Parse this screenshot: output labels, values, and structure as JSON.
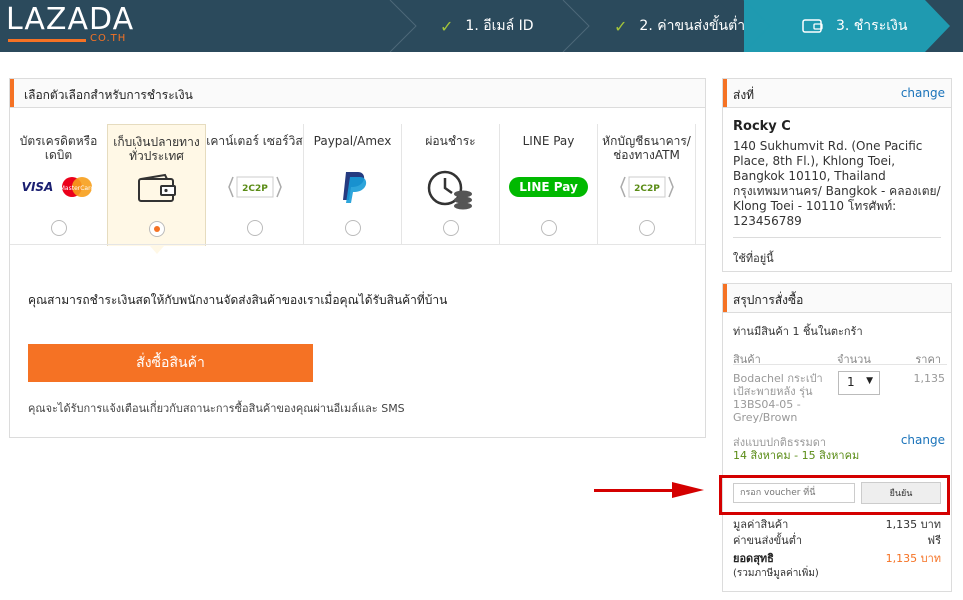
{
  "brand": {
    "logo_text": "LAZADA",
    "logo_sub": "CO.TH",
    "accent": "#f57224"
  },
  "steps": [
    {
      "label": "1. อีเมล์ ID",
      "done": true
    },
    {
      "label": "2. ค่าขนส่งขั้นต่ำ",
      "done": true
    },
    {
      "label": "3. ชำระเงิน",
      "done": false,
      "active": true
    }
  ],
  "payment": {
    "title": "เลือกตัวเลือกสำหรับการชำระเงิน",
    "methods": [
      {
        "label": "บัตรเครดิตหรือ เดบิต",
        "icon": "visa-mastercard-icon"
      },
      {
        "label": "เก็บเงินปลายทาง ทั่วประเทศ",
        "icon": "wallet-icon",
        "selected": true
      },
      {
        "label": "เคาน์เตอร์ เซอร์วิส",
        "icon": "counter-service-icon"
      },
      {
        "label": "Paypal/Amex",
        "icon": "paypal-icon"
      },
      {
        "label": "ผ่อนชำระ",
        "icon": "installment-icon"
      },
      {
        "label": "LINE Pay",
        "icon": "line-pay-icon",
        "badge": "LINE Pay"
      },
      {
        "label": "หักบัญชีธนาคาร/ ช่องทางATM",
        "icon": "bank-atm-icon"
      }
    ],
    "visa_text": "VISA",
    "mastercard_text": "MasterCard",
    "twoc2p_text": "2C2P",
    "description": "คุณสามารถชำระเงินสดให้กับพนักงานจัดส่งสินค้าของเราเมื่อคุณได้รับสินค้าที่บ้าน",
    "order_button": "สั่งซื้อสินค้า",
    "notify": "คุณจะได้รับการแจ้งเตือนเกี่ยวกับสถานะการซื้อสินค้าของคุณผ่านอีเมล์และ SMS"
  },
  "shipping": {
    "title": "ส่งที่",
    "change": "change",
    "name": "Rocky C",
    "address": "140 Sukhumvit Rd. (One Pacific Place, 8th Fl.), Khlong Toei, Bangkok 10110, Thailand กรุงเทพมหานคร/ Bangkok - คลองเตย/ Klong Toei - 10110 โทรศัพท์: 123456789",
    "use_this": "ใช้ที่อยู่นี้"
  },
  "summary": {
    "title": "สรุปการสั่งซื้อ",
    "count": "ท่านมีสินค้า 1 ชิ้นในตะกร้า",
    "col_product": "สินค้า",
    "col_qty": "จำนวน",
    "col_price": "ราคา",
    "item_name": "Bodachel กระเป๋าเป้สะพายหลัง รุ่น 13BS04-05 - Grey/Brown",
    "item_qty": "1",
    "item_price": "1,135",
    "ship_method": "ส่งแบบปกติธรรมดา",
    "ship_change": "change",
    "ship_dates": "14 สิงหาคม - 15 สิงหาคม",
    "voucher_placeholder": "กรอก voucher ที่นี่",
    "voucher_button": "ยืนยัน",
    "subtotal_label": "มูลค่าสินค้า",
    "subtotal_value": "1,135 บาท",
    "shipping_label": "ค่าขนส่งขั้นต่ำ",
    "shipping_value": "ฟรี",
    "total_label": "ยอดสุทธิ",
    "total_value": "1,135 บาท",
    "vat_note": "(รวมภาษีมูลค่าเพิ่ม)"
  },
  "colors": {
    "header": "#2b4a5c",
    "active_step": "#1f9ab0",
    "link": "#1a73ba",
    "highlight": "#d40000"
  }
}
